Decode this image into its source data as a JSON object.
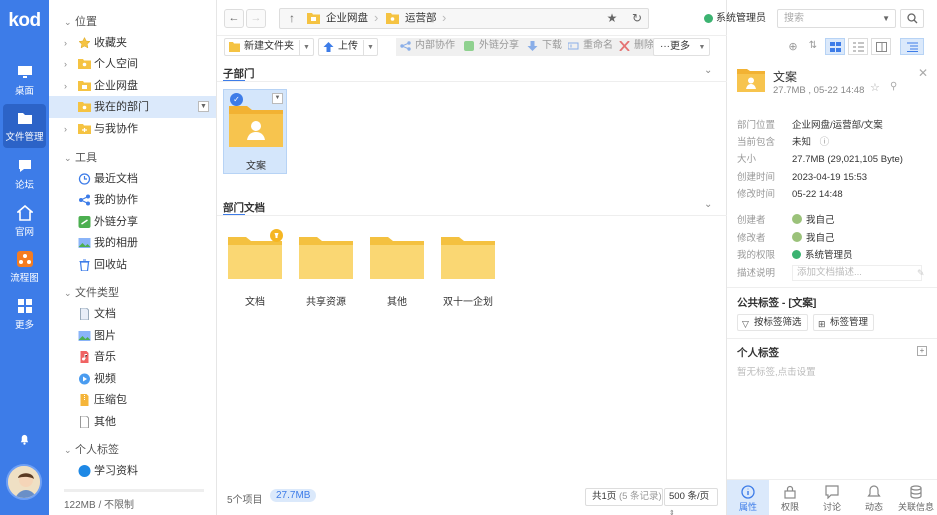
{
  "rail": {
    "logo": "kod",
    "items": [
      {
        "label": "桌面",
        "icon": "desktop-icon"
      },
      {
        "label": "文件管理",
        "icon": "folder-icon"
      },
      {
        "label": "论坛",
        "icon": "chat-icon"
      },
      {
        "label": "官网",
        "icon": "home-icon"
      },
      {
        "label": "流程图",
        "icon": "flowchart-icon"
      },
      {
        "label": "更多",
        "icon": "grid-icon"
      }
    ]
  },
  "tree": {
    "location_header": "位置",
    "locations": [
      {
        "label": "收藏夹",
        "icon": "star-icon"
      },
      {
        "label": "个人空间",
        "icon": "folder-icon"
      },
      {
        "label": "企业网盘",
        "icon": "folder-icon"
      },
      {
        "label": "我在的部门",
        "icon": "folder-icon"
      },
      {
        "label": "与我协作",
        "icon": "folder-icon"
      }
    ],
    "tools_header": "工具",
    "tools": [
      {
        "label": "最近文档",
        "icon": "clock-icon"
      },
      {
        "label": "我的协作",
        "icon": "share-nodes-icon"
      },
      {
        "label": "外链分享",
        "icon": "link-icon"
      },
      {
        "label": "我的相册",
        "icon": "image-icon"
      },
      {
        "label": "回收站",
        "icon": "trash-icon"
      }
    ],
    "types_header": "文件类型",
    "types": [
      {
        "label": "文档",
        "icon": "document-icon"
      },
      {
        "label": "图片",
        "icon": "image-icon"
      },
      {
        "label": "音乐",
        "icon": "music-icon"
      },
      {
        "label": "视频",
        "icon": "video-icon"
      },
      {
        "label": "压缩包",
        "icon": "archive-icon"
      },
      {
        "label": "其他",
        "icon": "file-icon"
      }
    ],
    "tags_header": "个人标签",
    "tags": [
      {
        "label": "学习资料",
        "color": "#1e88e5"
      }
    ],
    "quota": "122MB / 不限制"
  },
  "navbar": {
    "crumbs": [
      "企业网盘",
      "运营部"
    ],
    "user": "系统管理员",
    "search_placeholder": "搜索"
  },
  "toolbar": {
    "new_folder": "新建文件夹",
    "upload": "上传",
    "internal_collab": "内部协作",
    "external_share": "外链分享",
    "download": "下载",
    "rename": "重命名",
    "delete": "删除",
    "more": "更多"
  },
  "main": {
    "sub_dept_title": "子部门",
    "sub_dept": {
      "name": "文案"
    },
    "dept_docs_title": "部门文档",
    "folders": [
      {
        "name": "文档",
        "pinned": true
      },
      {
        "name": "共享资源",
        "pinned": false
      },
      {
        "name": "其他",
        "pinned": false
      },
      {
        "name": "双十一企划",
        "pinned": false
      }
    ],
    "status": {
      "count": "5个项目",
      "size": "27.7MB",
      "page": "共1页",
      "records": "(5 条记录)",
      "per_page": "500 条/页"
    }
  },
  "panel": {
    "title": "文案",
    "subtitle": "27.7MB , 05-22 14:48",
    "props": [
      {
        "key": "部门位置",
        "value": "企业网盘/运营部/文案"
      },
      {
        "key": "当前包含",
        "value": "未知"
      },
      {
        "key": "大小",
        "value": "27.7MB (29,021,105 Byte)"
      },
      {
        "key": "创建时间",
        "value": "2023-04-19 15:53"
      },
      {
        "key": "修改时间",
        "value": "05-22 14:48"
      }
    ],
    "people": [
      {
        "key": "创建者",
        "value": "我自己"
      },
      {
        "key": "修改者",
        "value": "我自己"
      },
      {
        "key": "我的权限",
        "value": "系统管理员"
      }
    ],
    "desc_key": "描述说明",
    "desc_placeholder": "添加文档描述...",
    "public_tags_title": "公共标签 - [文案]",
    "filter_btn": "按标签筛选",
    "manage_btn": "标签管理",
    "personal_tags_title": "个人标签",
    "personal_tags_empty": "暂无标签,点击设置",
    "tabs": [
      {
        "label": "属性",
        "icon": "info-icon"
      },
      {
        "label": "权限",
        "icon": "lock-icon"
      },
      {
        "label": "讨论",
        "icon": "comment-icon"
      },
      {
        "label": "动态",
        "icon": "bell-icon"
      },
      {
        "label": "关联信息",
        "icon": "database-icon"
      }
    ]
  },
  "colors": {
    "accent": "#3d7ce8",
    "folder": "#f5c342",
    "selected": "#dbe9fb",
    "admin_dot": "#3cb371"
  }
}
